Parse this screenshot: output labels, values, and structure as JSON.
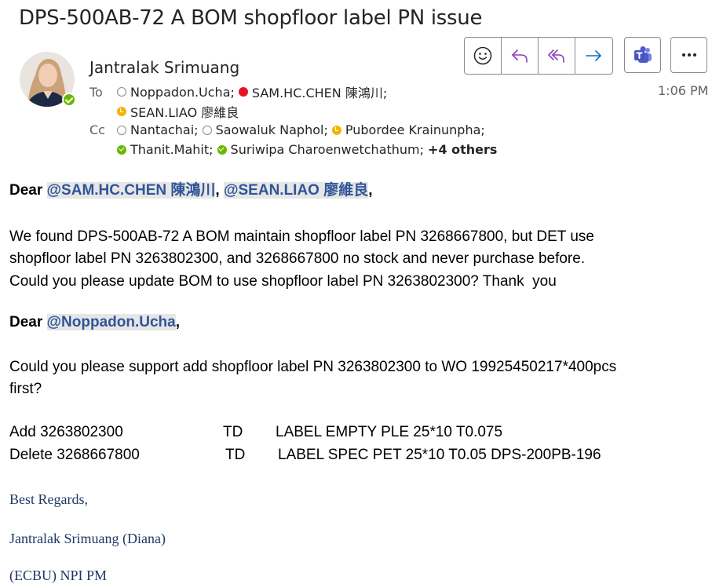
{
  "subject": "DPS-500AB-72 A BOM shopfloor label PN issue",
  "sender": "Jantralak Srimuang",
  "time": "1:06 PM",
  "to_label": "To",
  "cc_label": "Cc",
  "to": [
    {
      "name": "Noppadon.Ucha;",
      "status": "offline"
    },
    {
      "name": "SAM.HC.CHEN 陳鴻川;",
      "status": "busy"
    },
    {
      "name": "SEAN.LIAO 廖維良",
      "status": "away"
    }
  ],
  "cc": [
    {
      "name": "Nantachai;",
      "status": "offline"
    },
    {
      "name": "Saowaluk Naphol;",
      "status": "offline"
    },
    {
      "name": "Pubordee Krainunpha;",
      "status": "away"
    },
    {
      "name": "Thanit.Mahit;",
      "status": "available"
    },
    {
      "name": "Suriwipa Charoenwetchathum;",
      "status": "available"
    }
  ],
  "cc_more": "+4 others",
  "toolbar": {
    "icons": [
      "emoji-icon",
      "reply-icon",
      "reply-all-icon",
      "forward-icon",
      "teams-icon",
      "more-icon"
    ]
  },
  "body": {
    "greeting1_dear": "Dear ",
    "mention_sam": "@SAM.HC.CHEN 陳鴻川",
    "comma_space": ", ",
    "mention_sean": "@SEAN.LIAO 廖維良",
    "comma": ",",
    "para1_line1": "We found DPS-500AB-72 A BOM maintain shopfloor label PN 3268667800, but DET use",
    "para1_line2": "shopfloor label PN 3263802300, and 3268667800 no stock and never purchase before.",
    "para1_line3": "Could you please update BOM to use shopfloor label PN 3263802300? Thank  you",
    "greeting2_dear": "Dear ",
    "mention_noppadon": "@Noppadon.Ucha",
    "comma2": ",",
    "para2_line1": "Could you please support add shopfloor label PN 3263802300 to WO 19925450217*400pcs",
    "para2_line2": "first?",
    "bom_rows": [
      {
        "action": "Add 3263802300",
        "type": "TD",
        "desc": "LABEL EMPTY PLE 25*10 T0.075"
      },
      {
        "action": "Delete 3268667800",
        "type": "TD",
        "desc": "LABEL SPEC PET 25*10 T0.05 DPS-200PB-196"
      }
    ]
  },
  "signature": {
    "regards": "Best Regards,",
    "name": "Jantralak Srimuang (Diana)",
    "title": "(ECBU) NPI PM"
  },
  "colors": {
    "mention_text": "#2f5597",
    "mention_bg": "#e6e6e6",
    "accent_blue": "#0f6cbd",
    "presence_available": "#6bb700",
    "presence_busy": "#e81123",
    "presence_away": "#f4b400"
  }
}
